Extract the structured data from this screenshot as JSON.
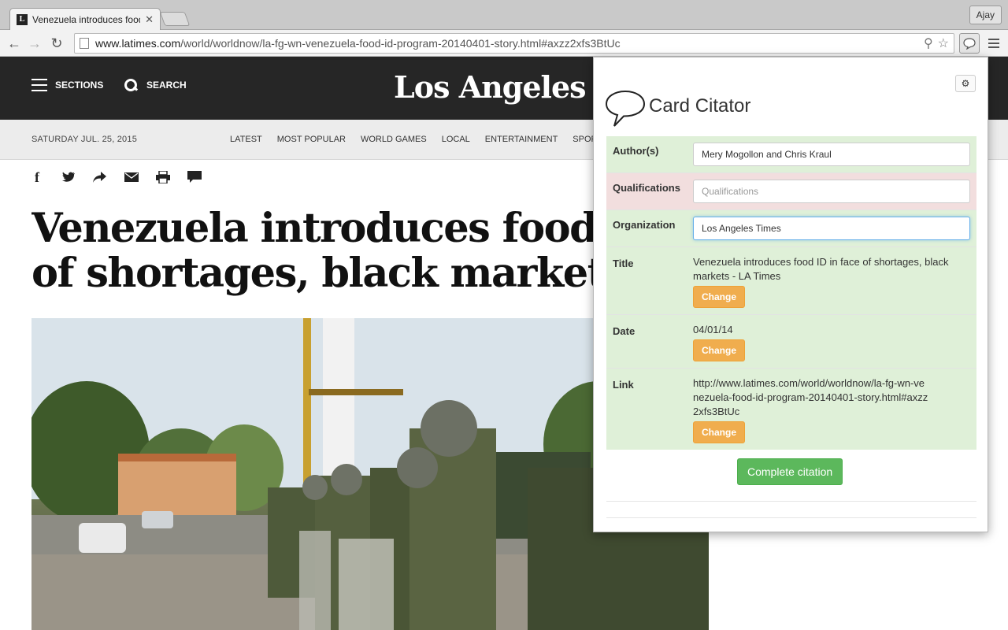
{
  "browser": {
    "tab_title": "Venezuela introduces food ID",
    "tab_favicon": "L",
    "profile_name": "Ajay",
    "url_host": "www.latimes.com",
    "url_path": "/world/worldnow/la-fg-wn-venezuela-food-id-program-20140401-story.html#axzz2xfs3BtUc",
    "icons": [
      "back-icon",
      "forward-icon",
      "reload-icon",
      "page-icon",
      "zoom-icon",
      "star-icon",
      "extension-bubble-icon",
      "menu-icon"
    ]
  },
  "site": {
    "sections_label": "SECTIONS",
    "search_label": "SEARCH",
    "logo_text": "Los Angeles Times",
    "date": "SATURDAY JUL. 25, 2015",
    "nav": [
      "LATEST",
      "MOST POPULAR",
      "WORLD GAMES",
      "LOCAL",
      "ENTERTAINMENT",
      "SPORTS"
    ],
    "share_icons": [
      "facebook-icon",
      "twitter-icon",
      "share-icon",
      "email-icon",
      "print-icon",
      "comment-icon"
    ],
    "headline_line1": "Venezuela introduces food ID in face",
    "headline_line2": "of shortages, black markets"
  },
  "popup": {
    "title": "Card Citator",
    "author": {
      "label": "Author(s)",
      "value": "Mery Mogollon and Chris Kraul"
    },
    "qualifications": {
      "label": "Qualifications",
      "value": "",
      "placeholder": "Qualifications"
    },
    "organization": {
      "label": "Organization",
      "value": "Los Angeles Times"
    },
    "title_field": {
      "label": "Title",
      "value": "Venezuela introduces food ID in face of shortages, black markets - LA Times"
    },
    "date_field": {
      "label": "Date",
      "value": "04/01/14"
    },
    "link_field": {
      "label": "Link",
      "value": "http://www.latimes.com/world/worldnow/la-fg-wn-venezuela-food-id-program-20140401-story.html#axzz2xfs3BtUc"
    },
    "change_label": "Change",
    "complete_label": "Complete citation",
    "colors": {
      "ok": "#dff0d8",
      "bad": "#f2dede",
      "warning_btn": "#f0ad4e",
      "success_btn": "#5cb85c"
    }
  }
}
